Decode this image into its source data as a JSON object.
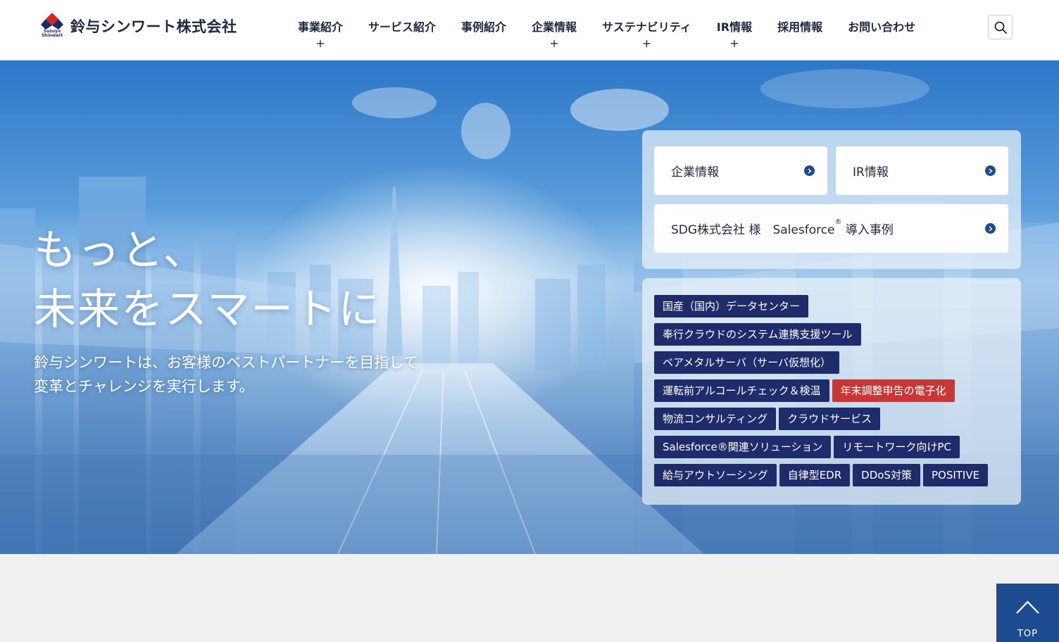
{
  "brand": {
    "name": "鈴与シンワート株式会社",
    "sub": "Suzuyo Shinwart",
    "colors": {
      "red": "#d7252a",
      "blue": "#1b2a6b"
    }
  },
  "nav": {
    "items": [
      {
        "label": "事業紹介",
        "expandable": "+"
      },
      {
        "label": "サービス紹介",
        "expandable": ""
      },
      {
        "label": "事例紹介",
        "expandable": ""
      },
      {
        "label": "企業情報",
        "expandable": "+"
      },
      {
        "label": "サステナビリティ",
        "expandable": "+"
      },
      {
        "label": "IR情報",
        "expandable": "+"
      },
      {
        "label": "採用情報",
        "expandable": ""
      },
      {
        "label": "お問い合わせ",
        "expandable": ""
      }
    ],
    "search_icon": "search-icon"
  },
  "hero": {
    "title_line1": "もっと、",
    "title_line2": "未来をスマートに",
    "sub_line1": "鈴与シンワートは、お客様のベストパートナーを目指して",
    "sub_line2": "変革とチャレンジを実行します。"
  },
  "links": {
    "corporate": "企業情報",
    "ir": "IR情報",
    "case_prefix": "SDG株式会社 様　Salesforce",
    "case_reg": "®",
    "case_suffix": " 導入事例"
  },
  "tags": {
    "rows": [
      [
        {
          "label": "国産（国内）データセンター",
          "highlight": false
        }
      ],
      [
        {
          "label": "奉行クラウドのシステム連携支援ツール",
          "highlight": false
        }
      ],
      [
        {
          "label": "ベアメタルサーバ（サーバ仮想化）",
          "highlight": false
        }
      ],
      [
        {
          "label": "運転前アルコールチェック＆検温",
          "highlight": false
        },
        {
          "label": "年末調整申告の電子化",
          "highlight": true
        }
      ],
      [
        {
          "label": "物流コンサルティング",
          "highlight": false
        },
        {
          "label": "クラウドサービス",
          "highlight": false
        }
      ],
      [
        {
          "label": "Salesforce®関連ソリューション",
          "highlight": false
        },
        {
          "label": "リモートワーク向けPC",
          "highlight": false
        }
      ],
      [
        {
          "label": "給与アウトソーシング",
          "highlight": false
        },
        {
          "label": "自律型EDR",
          "highlight": false
        },
        {
          "label": "DDoS対策",
          "highlight": false
        },
        {
          "label": "POSITIVE",
          "highlight": false
        }
      ]
    ]
  },
  "to_top": {
    "label": "TOP"
  }
}
